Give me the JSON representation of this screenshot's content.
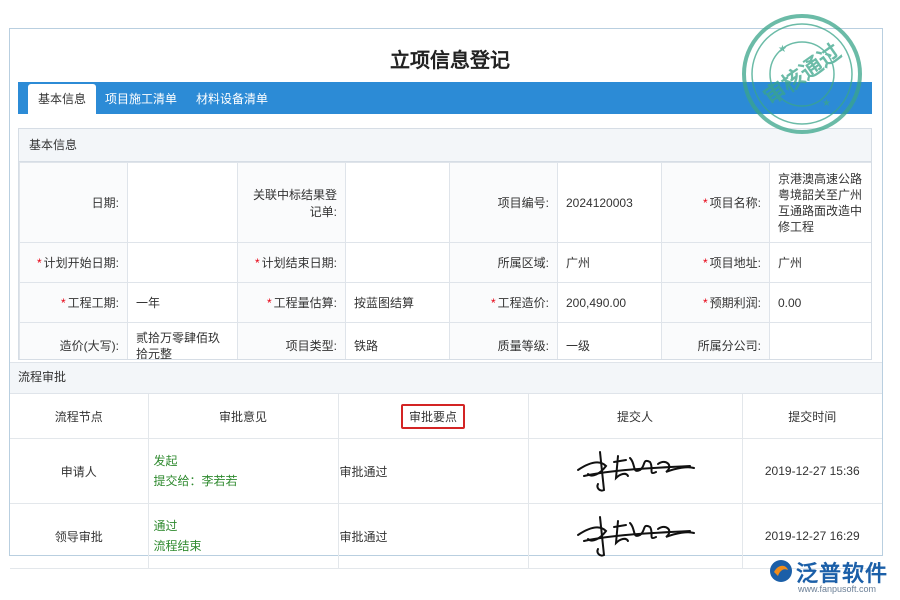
{
  "page_title": "立项信息登记",
  "tabs": [
    {
      "label": "基本信息",
      "active": true
    },
    {
      "label": "项目施工清单",
      "active": false
    },
    {
      "label": "材料设备清单",
      "active": false
    }
  ],
  "basic_section": {
    "heading": "基本信息",
    "fields": {
      "date": {
        "label": "日期:",
        "value": ""
      },
      "bid_ref": {
        "label": "关联中标结果登记单:",
        "value": ""
      },
      "project_no": {
        "label": "项目编号:",
        "value": "2024120003"
      },
      "project_name": {
        "label": "项目名称:",
        "value": "京港澳高速公路粤境韶关至广州互通路面改造中修工程"
      },
      "plan_start": {
        "label": "计划开始日期:",
        "value": ""
      },
      "plan_end": {
        "label": "计划结束日期:",
        "value": ""
      },
      "region": {
        "label": "所属区域:",
        "value": "广州"
      },
      "address": {
        "label": "项目地址:",
        "value": "广州"
      },
      "duration": {
        "label": "工程工期:",
        "value": "一年"
      },
      "quantity_est": {
        "label": "工程量估算:",
        "value": "按蓝图结算"
      },
      "cost": {
        "label": "工程造价:",
        "value": "200,490.00"
      },
      "profit": {
        "label": "预期利润:",
        "value": "0.00"
      },
      "cost_upper": {
        "label": "造价(大写):",
        "value": "贰拾万零肆佰玖拾元整"
      },
      "project_type": {
        "label": "项目类型:",
        "value": "铁路"
      },
      "quality": {
        "label": "质量等级:",
        "value": "一级"
      },
      "branch": {
        "label": "所属分公司:",
        "value": ""
      }
    }
  },
  "flow": {
    "heading": "流程审批",
    "columns": [
      "流程节点",
      "审批意见",
      "审批要点",
      "提交人",
      "提交时间"
    ],
    "rows": [
      {
        "node": "申请人",
        "action": "发起",
        "detail": "提交给：李若若",
        "note": "审批通过",
        "time": "2019-12-27 15:36"
      },
      {
        "node": "领导审批",
        "action": "通过",
        "detail": "流程结束",
        "note": "审批通过",
        "time": "2019-12-27 16:29"
      }
    ]
  },
  "stamp": {
    "text": "审核通过",
    "color": "#3aa58a"
  },
  "brand": {
    "name": "泛普软件",
    "url": "www.fanpusoft.com"
  },
  "colors": {
    "tab_bar": "#2c8bd6",
    "required": "#e60012",
    "status_green": "#2f8a2f",
    "highlight_border": "#d32424"
  }
}
